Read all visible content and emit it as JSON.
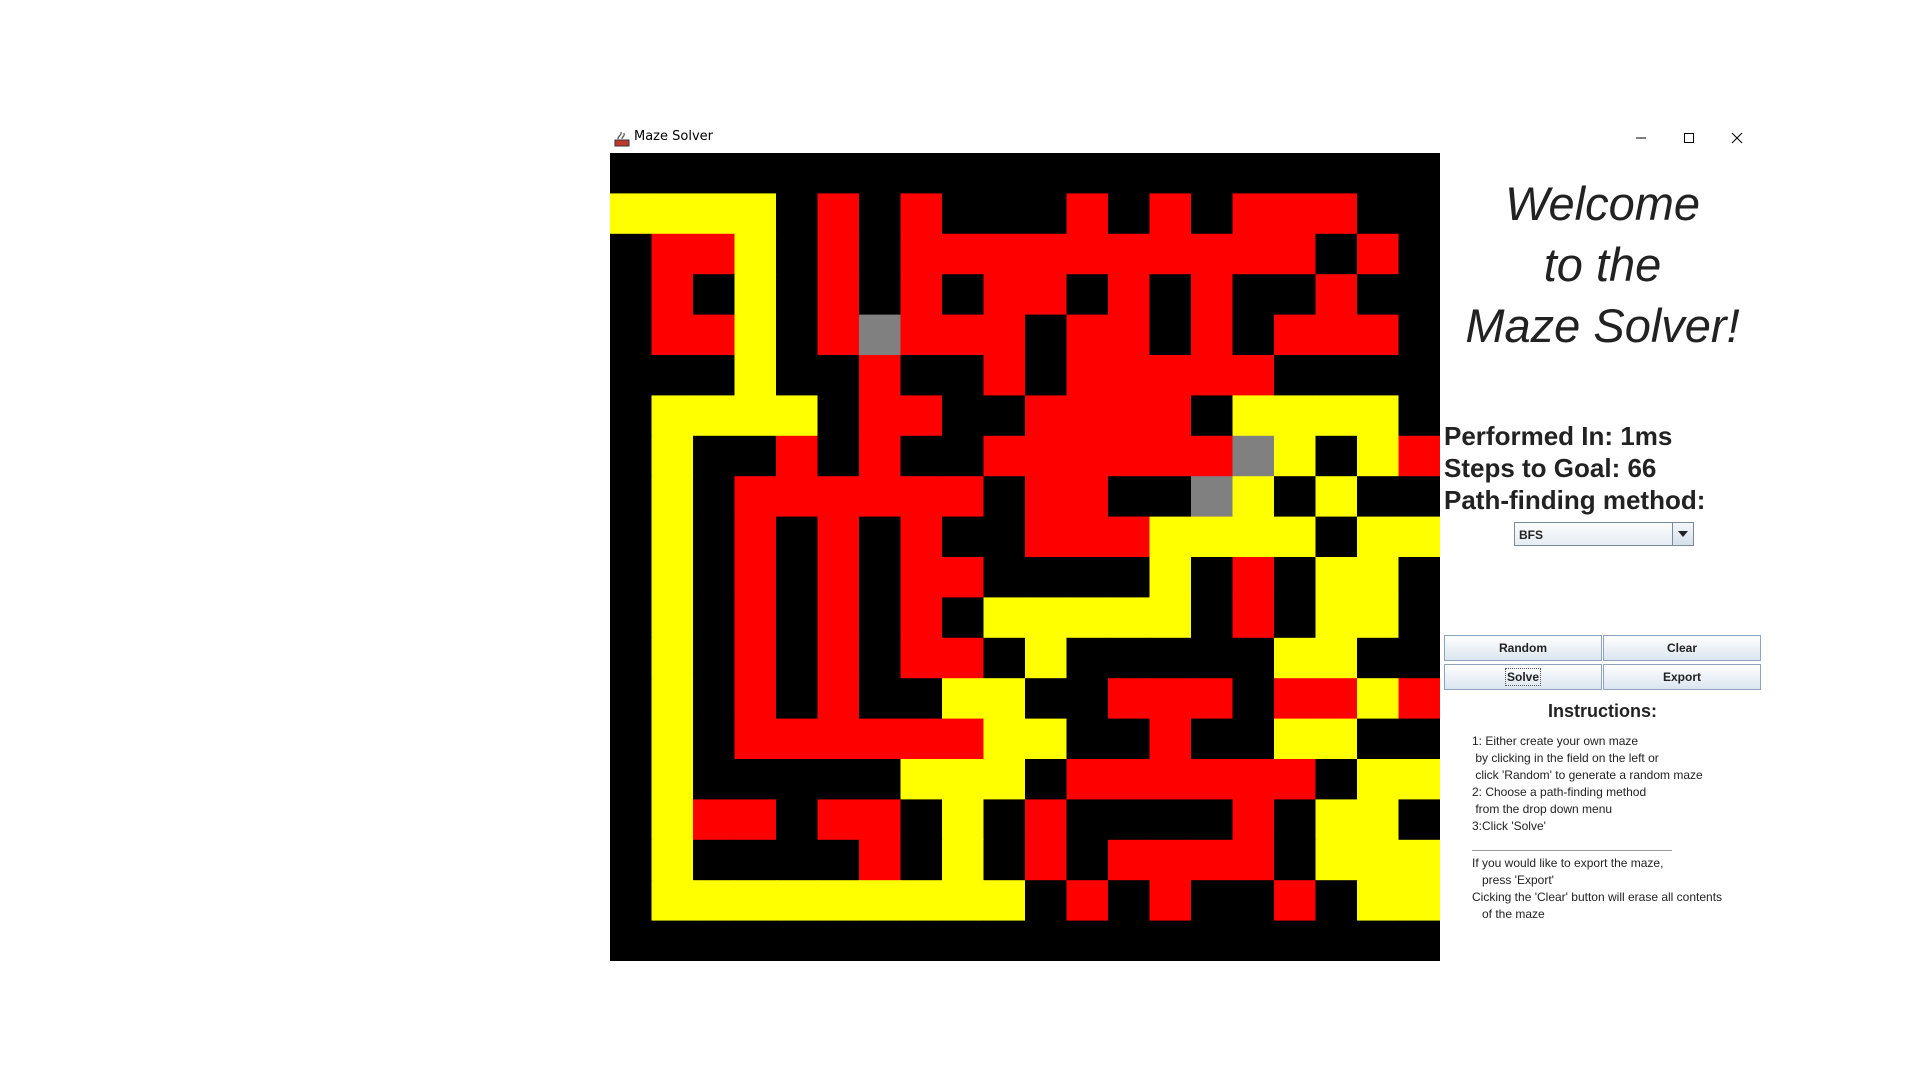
{
  "window": {
    "title": "Maze Solver",
    "controls": [
      "minimize-icon",
      "maximize-icon",
      "close-icon"
    ]
  },
  "maze": {
    "rows": 20,
    "cols": 20,
    "legend_colors": {
      "wall": "#000000",
      "explored": "#ff0000",
      "path": "#ffff00",
      "unvisited": "#808080"
    },
    "grid": [
      "####################",
      "YYYY#R#R###R#R#RRR##",
      "#RRY#R#RRRRRRRRRR#R#",
      "#R#Y#R#R#RR#R#R##R#",
      "#RRY#RGRRR#RR#R#RRR#",
      "###Y##R##R#RRRRR####",
      "#YYYY#RR##RRRR#YYYY#",
      "#Y##R#R##RRRRRRGY#YR#",
      "#Y#RRRRRR#RR##GY#Y##",
      "#Y#R#R#R##RRRYYYY#YY#",
      "#Y#R#R#RR####Y#R#YY#",
      "#Y#R#R#R#YYYYY#R#YY#",
      "#Y#R#R#RR#Y#####YY##",
      "#Y#R#R##YY##RRR#RRYR#",
      "#Y#RRRRRRYY##R##YY##",
      "#Y#####YYY#RRRRRR#YY#",
      "#YRR#RR#Y#R####R#YY#",
      "#Y####R#Y#R#RRRR#YYY",
      "#YYYYYYYYY#R#R##R#YY",
      "####################"
    ]
  },
  "panel": {
    "welcome_lines": [
      "Welcome",
      "to the",
      "Maze Solver!"
    ],
    "performed_in": "Performed In: 1ms",
    "steps_to_goal": "Steps to Goal: 66",
    "method_label": "Path-finding method:",
    "method_selected": "BFS",
    "buttons": {
      "random": "Random",
      "clear": "Clear",
      "solve": "Solve",
      "export": "Export"
    },
    "instructions_title": "Instructions:",
    "instructions_lines": [
      "1: Either create your own maze",
      " by clicking in the field on the left or",
      " click 'Random' to generate a random maze",
      "2: Choose a path-finding method",
      " from the drop down menu",
      "3:Click 'Solve'"
    ],
    "notes_lines": [
      "If you would like to export the maze,",
      "   press 'Export'",
      "Cicking the 'Clear' button will erase all contents",
      "   of the maze"
    ]
  }
}
